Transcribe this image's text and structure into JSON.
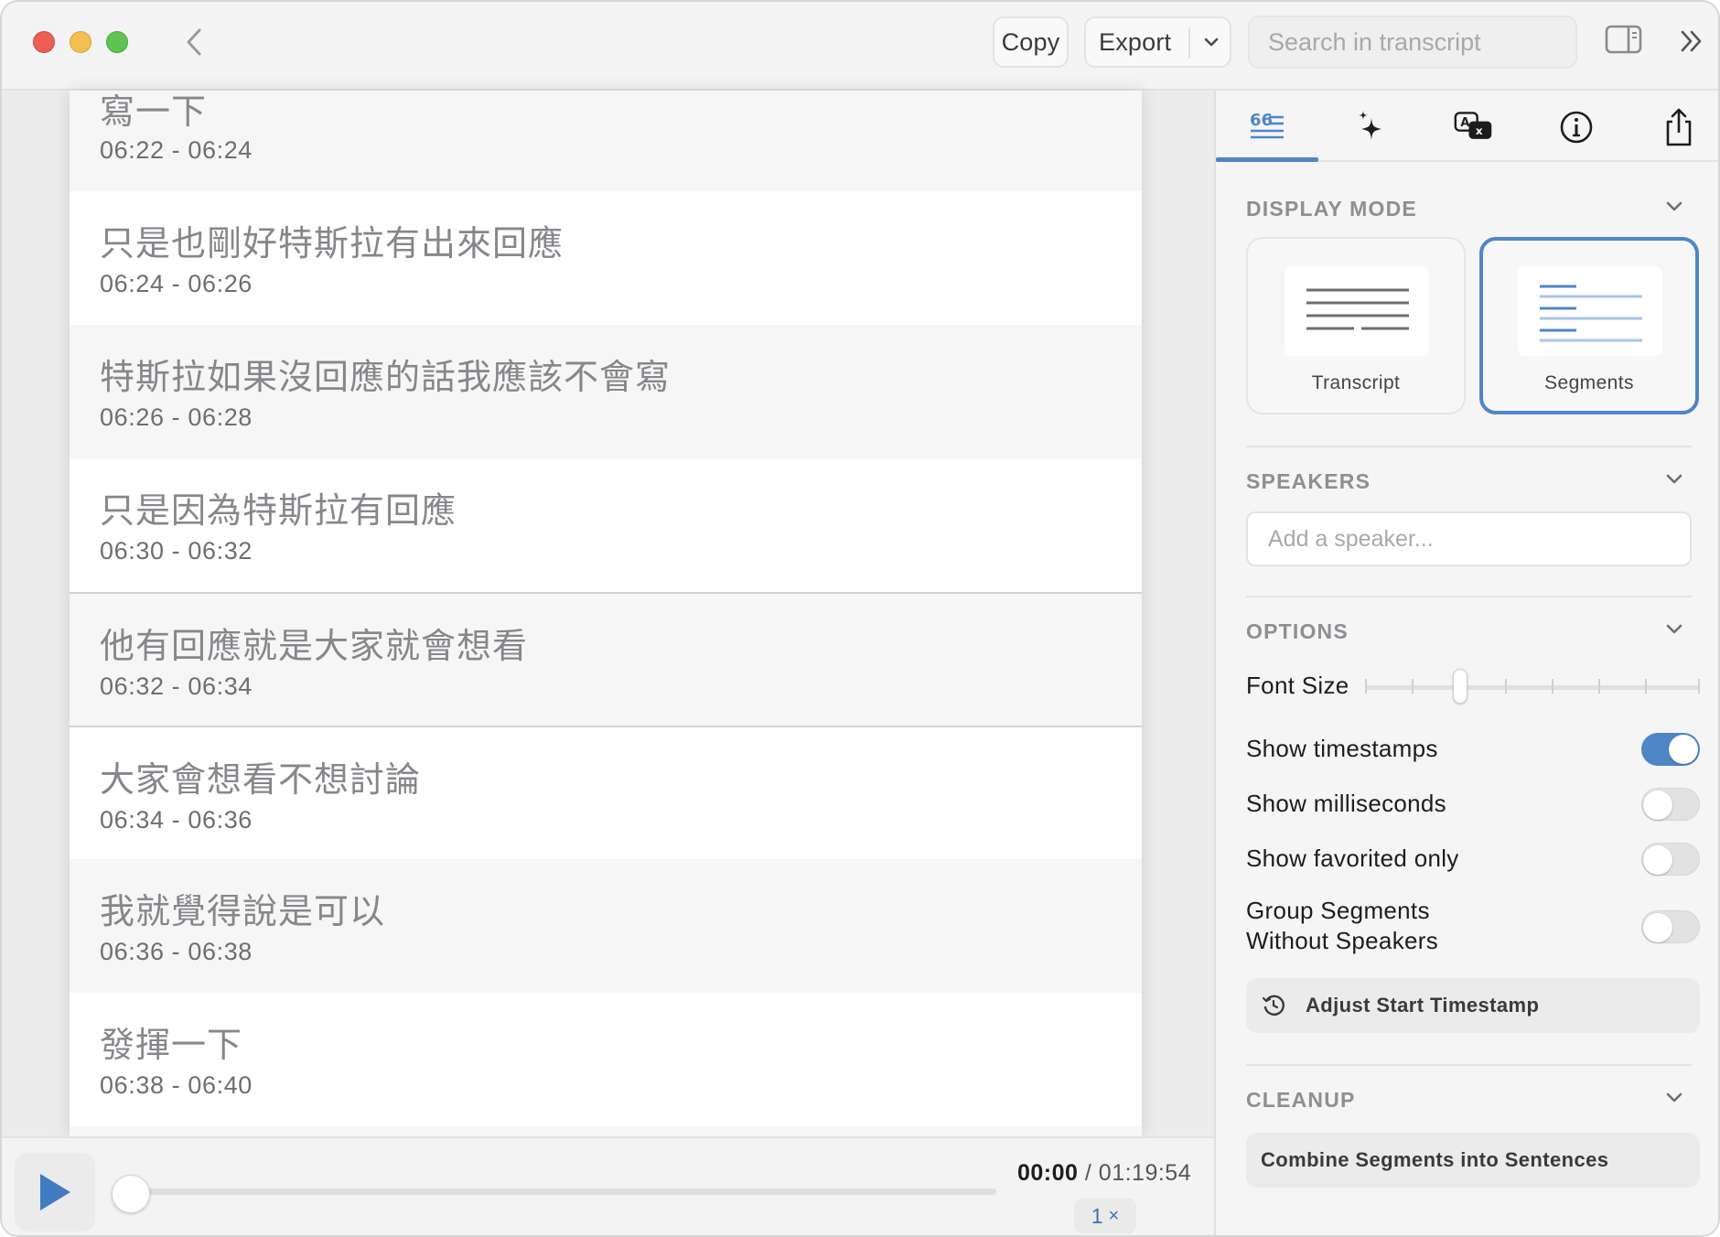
{
  "toolbar": {
    "copy_label": "Copy",
    "export_label": "Export",
    "search_placeholder": "Search in transcript"
  },
  "segments": [
    {
      "text": "寫一下",
      "time": "06:22 - 06:24"
    },
    {
      "text": "只是也剛好特斯拉有出來回應",
      "time": "06:24 - 06:26"
    },
    {
      "text": "特斯拉如果沒回應的話我應該不會寫",
      "time": "06:26 - 06:28"
    },
    {
      "text": "只是因為特斯拉有回應",
      "time": "06:30 - 06:32"
    },
    {
      "text": "他有回應就是大家就會想看",
      "time": "06:32 - 06:34"
    },
    {
      "text": "大家會想看不想討論",
      "time": "06:34 - 06:36"
    },
    {
      "text": "我就覺得說是可以",
      "time": "06:36 - 06:38"
    },
    {
      "text": "發揮一下",
      "time": "06:38 - 06:40"
    }
  ],
  "player": {
    "current_time": "00:00",
    "separator": " / ",
    "total_time": "01:19:54",
    "speed_value": "1",
    "speed_suffix": "×",
    "progress": 0
  },
  "sidebar": {
    "tabs": [
      {
        "name": "transcript-view-icon",
        "active": true
      },
      {
        "name": "sparkle-icon",
        "active": false
      },
      {
        "name": "translate-icon",
        "active": false
      },
      {
        "name": "info-icon",
        "active": false
      },
      {
        "name": "share-icon",
        "active": false
      }
    ],
    "display_mode": {
      "title": "DISPLAY MODE",
      "options": [
        "Transcript",
        "Segments"
      ],
      "selected": "Segments"
    },
    "speakers": {
      "title": "SPEAKERS",
      "placeholder": "Add a speaker..."
    },
    "options": {
      "title": "OPTIONS",
      "font_size_label": "Font Size",
      "font_size_level": 2,
      "font_size_steps": 8,
      "show_timestamps": {
        "label": "Show timestamps",
        "on": true
      },
      "show_milliseconds": {
        "label": "Show milliseconds",
        "on": false
      },
      "show_favorited": {
        "label": "Show favorited only",
        "on": false
      },
      "group_segments": {
        "label_line1": "Group Segments",
        "label_line2": "Without Speakers",
        "on": false
      },
      "adjust_button": "Adjust Start Timestamp"
    },
    "cleanup": {
      "title": "CLEANUP",
      "combine_button": "Combine Segments into Sentences"
    }
  },
  "colors": {
    "accent": "#4e86c7",
    "close": "#ec5f57",
    "minimize": "#f4bf4f",
    "zoom": "#5fc454"
  }
}
